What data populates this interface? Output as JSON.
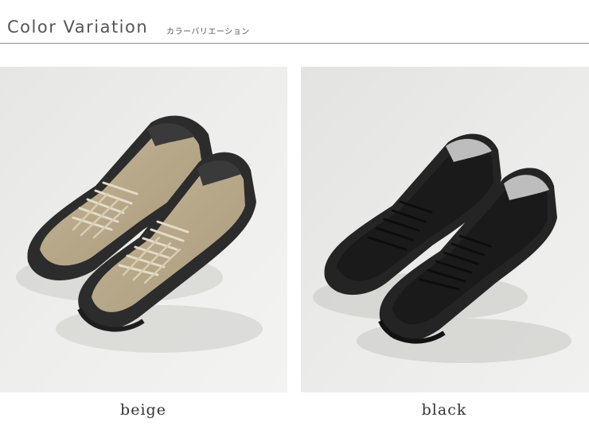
{
  "header": {
    "title": "Color Variation",
    "subtitle": "カラーバリエーション"
  },
  "variants": [
    {
      "label": "beige",
      "upper_color": "#b5a586",
      "sole_color": "#2b2b2b"
    },
    {
      "label": "black",
      "upper_color": "#1c1c1c",
      "sole_color": "#242424"
    }
  ]
}
